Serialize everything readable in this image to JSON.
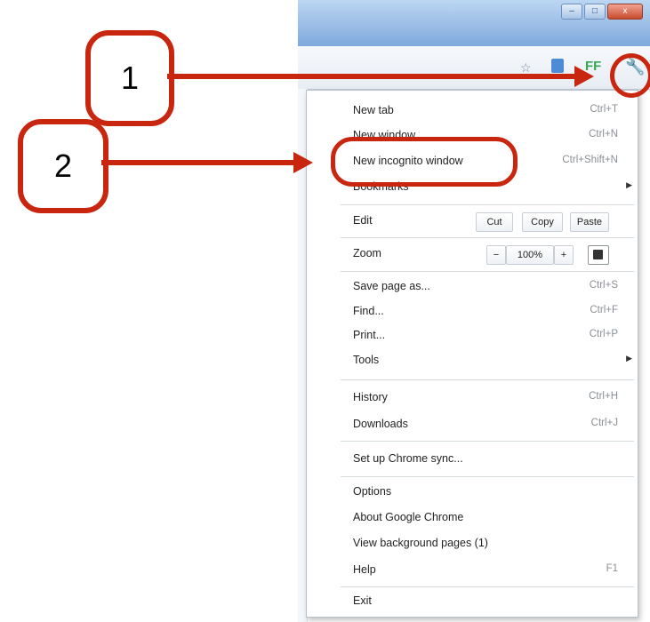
{
  "browser": {
    "window_buttons": [
      "–",
      "□",
      "x"
    ],
    "toolbar": {
      "ff_label": "FF"
    }
  },
  "annotations": {
    "callout_1": "1",
    "callout_2": "2"
  },
  "menu": {
    "new_tab": {
      "label": "New tab",
      "shortcut": "Ctrl+T"
    },
    "new_window": {
      "label": "New window",
      "shortcut": "Ctrl+N"
    },
    "new_incognito": {
      "label": "New incognito window",
      "shortcut": "Ctrl+Shift+N"
    },
    "bookmarks": {
      "label": "Bookmarks"
    },
    "edit": {
      "label": "Edit",
      "cut": "Cut",
      "copy": "Copy",
      "paste": "Paste"
    },
    "zoom": {
      "label": "Zoom",
      "minus": "−",
      "value": "100%",
      "plus": "+"
    },
    "save_page": {
      "label": "Save page as...",
      "shortcut": "Ctrl+S"
    },
    "find": {
      "label": "Find...",
      "shortcut": "Ctrl+F"
    },
    "print": {
      "label": "Print...",
      "shortcut": "Ctrl+P"
    },
    "tools": {
      "label": "Tools"
    },
    "history": {
      "label": "History",
      "shortcut": "Ctrl+H"
    },
    "downloads": {
      "label": "Downloads",
      "shortcut": "Ctrl+J"
    },
    "sync": {
      "label": "Set up Chrome sync..."
    },
    "options": {
      "label": "Options"
    },
    "about": {
      "label": "About Google Chrome"
    },
    "background_pages": {
      "label": "View background pages (1)"
    },
    "help": {
      "label": "Help",
      "shortcut": "F1"
    },
    "exit": {
      "label": "Exit"
    }
  }
}
